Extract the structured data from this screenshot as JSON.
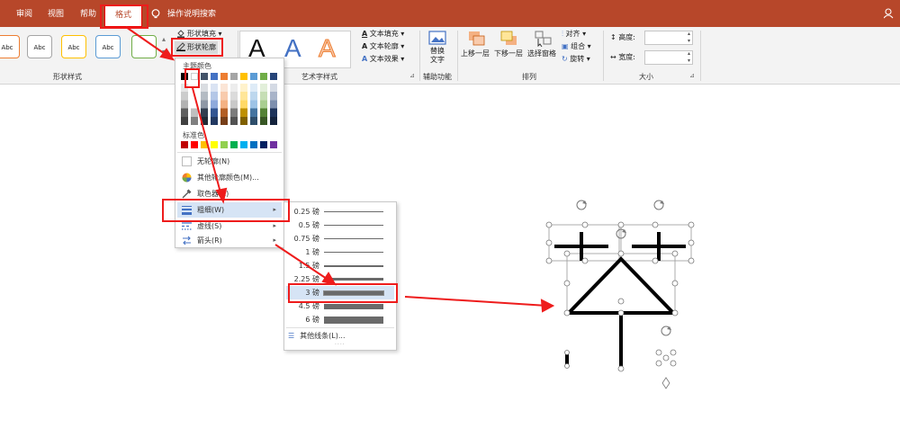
{
  "tabs": [
    "审阅",
    "视图",
    "帮助",
    "格式",
    "操作说明搜索"
  ],
  "ribbon": {
    "shape_style_chip": "Abc",
    "shape_fill": "形状填充",
    "shape_outline": "形状轮廓",
    "shape_styles_label": "形状样式",
    "wordart_letter": "A",
    "text_fill": "文本填充",
    "text_outline": "文本轮廓",
    "text_effect": "文本效果",
    "wordart_label": "艺术字样式",
    "alt_text_line1": "替换",
    "alt_text_line2": "文字",
    "accessibility_label": "辅助功能",
    "bring_forward": "上移一层",
    "send_backward": "下移一层",
    "selection_pane": "选择窗格",
    "align": "对齐",
    "group": "组合",
    "rotate": "旋转",
    "arrange_label": "排列",
    "height_label": "高度:",
    "width_label": "宽度:",
    "size_label": "大小"
  },
  "dropdown": {
    "theme_colors_label": "主题颜色",
    "standard_colors_label": "标准色",
    "no_outline": "无轮廓(N)",
    "more_colors": "其他轮廓颜色(M)...",
    "eyedropper": "取色器(E)",
    "weight": "粗细(W)",
    "dashes": "虚线(S)",
    "arrows": "箭头(R)"
  },
  "submenu": {
    "weights": [
      {
        "label": "0.25 磅",
        "pt": 0.25
      },
      {
        "label": "0.5 磅",
        "pt": 0.5
      },
      {
        "label": "0.75 磅",
        "pt": 0.75
      },
      {
        "label": "1 磅",
        "pt": 1
      },
      {
        "label": "1.5 磅",
        "pt": 1.5
      },
      {
        "label": "2.25 磅",
        "pt": 2.25
      },
      {
        "label": "3 磅",
        "pt": 3
      },
      {
        "label": "4.5 磅",
        "pt": 4.5
      },
      {
        "label": "6 磅",
        "pt": 6
      }
    ],
    "selected": "3 磅",
    "more_lines": "其他线条(L)..."
  },
  "colors": {
    "theme_row": [
      "#000000",
      "#ffffff",
      "#44546a",
      "#4472c4",
      "#ed7d31",
      "#a5a5a5",
      "#ffc000",
      "#5b9bd5",
      "#70ad47",
      "#264478"
    ],
    "standard": [
      "#c00000",
      "#ff0000",
      "#ffc000",
      "#ffff00",
      "#92d050",
      "#00b050",
      "#00b0f0",
      "#0070c0",
      "#002060",
      "#7030a0"
    ],
    "accent": "#b7472a",
    "highlight": "#ee1c1c"
  }
}
